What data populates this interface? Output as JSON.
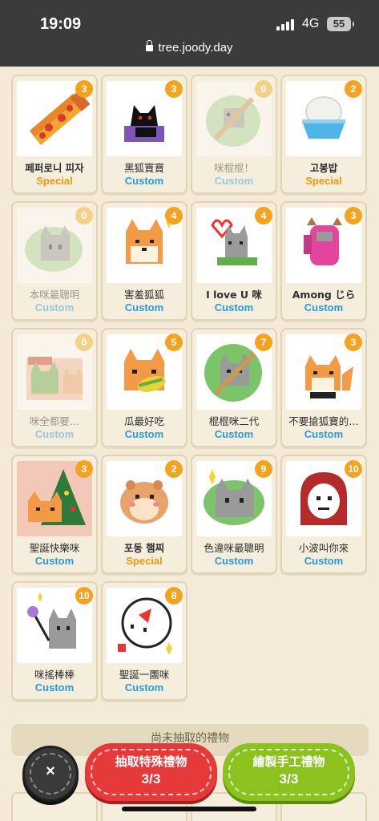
{
  "status": {
    "time": "19:09",
    "network": "4G",
    "battery": "55"
  },
  "browser": {
    "url": "tree.joody.day"
  },
  "cards": [
    {
      "name": "페퍼로니 피자",
      "tag": "Special",
      "count": "3",
      "faded": false,
      "bold": true,
      "icon": "pizza-icon"
    },
    {
      "name": "黑狐寶寶",
      "tag": "Custom",
      "count": "3",
      "faded": false,
      "bold": false,
      "icon": "black-fox-icon"
    },
    {
      "name": "咪棍棍！",
      "tag": "Custom",
      "count": "0",
      "faded": true,
      "bold": false,
      "icon": "cat-stick-icon"
    },
    {
      "name": "고봉밥",
      "tag": "Special",
      "count": "2",
      "faded": false,
      "bold": true,
      "icon": "rice-bowl-icon"
    },
    {
      "name": "本咪最聰明",
      "tag": "Custom",
      "count": "0",
      "faded": true,
      "bold": false,
      "icon": "smart-cat-icon"
    },
    {
      "name": "害羞狐狐",
      "tag": "Custom",
      "count": "4",
      "faded": false,
      "bold": false,
      "icon": "shy-fox-icon"
    },
    {
      "name": "I love U 咪",
      "tag": "Custom",
      "count": "4",
      "faded": false,
      "bold": false,
      "icon": "love-cat-icon"
    },
    {
      "name": "Among じら",
      "tag": "Custom",
      "count": "3",
      "faded": false,
      "bold": false,
      "icon": "among-icon"
    },
    {
      "name": "咪全都要…",
      "tag": "Custom",
      "count": "0",
      "faded": true,
      "bold": false,
      "icon": "cat-want-all-icon"
    },
    {
      "name": "瓜最好吃",
      "tag": "Custom",
      "count": "5",
      "faded": false,
      "bold": false,
      "icon": "fox-corn-icon"
    },
    {
      "name": "棍棍咪二代",
      "tag": "Custom",
      "count": "7",
      "faded": false,
      "bold": false,
      "icon": "cat-stick-2-icon"
    },
    {
      "name": "不要搶狐寶的…",
      "tag": "Custom",
      "count": "3",
      "faded": false,
      "bold": false,
      "icon": "fox-baby-icon"
    },
    {
      "name": "聖誕快樂咪",
      "tag": "Custom",
      "count": "3",
      "faded": false,
      "bold": false,
      "icon": "xmas-cat-icon"
    },
    {
      "name": "포동 햄찌",
      "tag": "Special",
      "count": "2",
      "faded": false,
      "bold": true,
      "icon": "hamster-icon"
    },
    {
      "name": "色違咪最聰明",
      "tag": "Custom",
      "count": "9",
      "faded": false,
      "bold": false,
      "icon": "shiny-cat-icon"
    },
    {
      "name": "小波叫你來",
      "tag": "Custom",
      "count": "10",
      "faded": false,
      "bold": false,
      "icon": "hooded-girl-icon"
    },
    {
      "name": "咪搖棒棒",
      "tag": "Custom",
      "count": "10",
      "faded": false,
      "bold": false,
      "icon": "cat-wand-icon"
    },
    {
      "name": "聖誕一團咪",
      "tag": "Custom",
      "count": "8",
      "faded": false,
      "bold": false,
      "icon": "xmas-cat-ball-icon"
    }
  ],
  "section": {
    "title": "尚未抽取的禮物"
  },
  "actions": {
    "close": "×",
    "draw_special": {
      "label": "抽取特殊禮物",
      "count": "3/3"
    },
    "draw_custom": {
      "label": "繪製手工禮物",
      "count": "3/3"
    }
  },
  "colors": {
    "custom": "#2a9ad6",
    "special": "#e69a10",
    "badge": "#f3a321",
    "red_button": "#e63a3a",
    "green_button": "#8cc21f"
  }
}
